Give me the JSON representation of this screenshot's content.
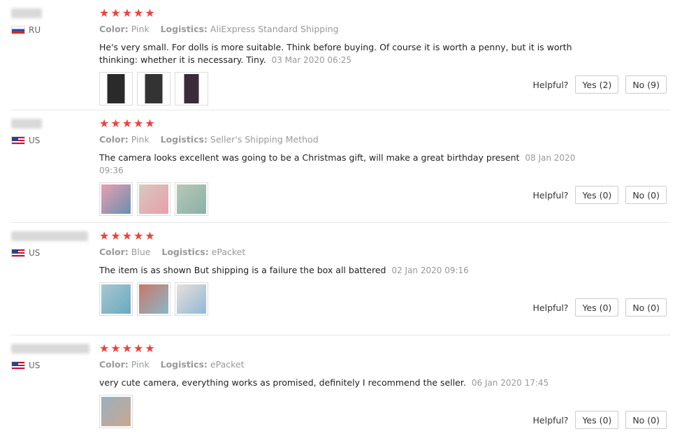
{
  "labels": {
    "color_key": "Color:",
    "logistics_key": "Logistics:",
    "helpful": "Helpful?",
    "stars": "★★★★★"
  },
  "reviews": [
    {
      "country": "RU",
      "color": "Pink",
      "logistics": "AliExpress Standard Shipping",
      "text": "He's very small. For dolls is more suitable. Think before buying. Of course it is worth a penny, but it is worth thinking: whether it is necessary. Tiny.",
      "date": "03 Mar 2020 06:25",
      "yes": "Yes (2)",
      "no": "No (9)"
    },
    {
      "country": "US",
      "color": "Pink",
      "logistics": "Seller's Shipping Method",
      "text": "The camera looks excellent was going to be a Christmas gift, will make a great birthday present",
      "date": "08 Jan 2020 09:36",
      "yes": "Yes (0)",
      "no": "No (0)"
    },
    {
      "country": "US",
      "color": "Blue",
      "logistics": "ePacket",
      "text": "The item is as shown But shipping is a failure the box all battered",
      "date": "02 Jan 2020 09:16",
      "yes": "Yes (0)",
      "no": "No (0)"
    },
    {
      "country": "US",
      "color": "Pink",
      "logistics": "ePacket",
      "text": "very cute camera, everything works as promised, definitely I recommend the seller.",
      "date": "06 Jan 2020 17:45",
      "yes": "Yes (0)",
      "no": "No (0)"
    }
  ]
}
